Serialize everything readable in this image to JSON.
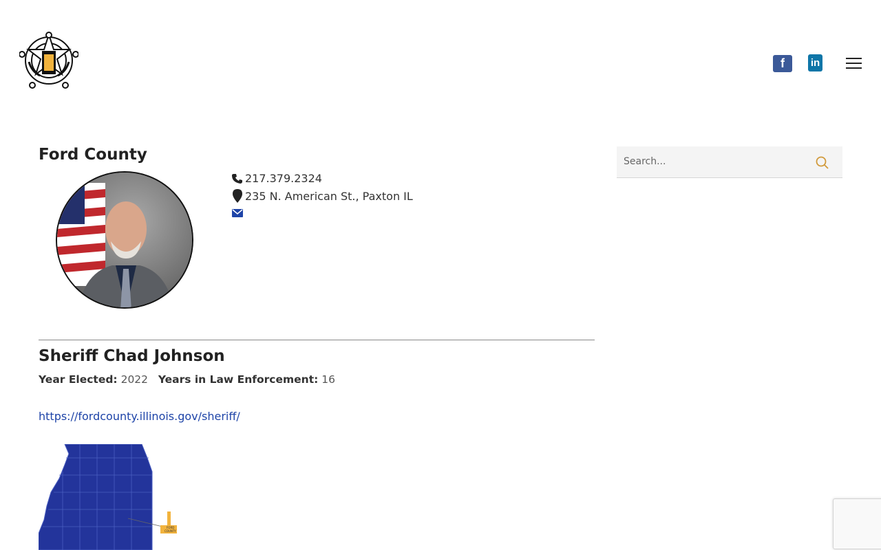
{
  "header": {
    "logo_name": "Illinois Sheriffs' Association seal",
    "facebook_label": "f",
    "linkedin_label": "in"
  },
  "profile": {
    "county": "Ford County",
    "phone": "217.379.2324",
    "address": "235 N. American St., Paxton IL",
    "sheriff_name": "Sheriff Chad Johnson",
    "year_elected_label": "Year Elected:",
    "year_elected": "2022",
    "years_enforcement_label": "Years in Law Enforcement:",
    "years_enforcement": "16",
    "website": "https://fordcounty.illinois.gov/sheriff/"
  },
  "map": {
    "county_label_line1": "FORD",
    "county_label_line2": "COUNTY",
    "state_color": "#23349b",
    "highlight_color": "#f2b33d"
  },
  "sidebar": {
    "search_placeholder": "Search..."
  },
  "colors": {
    "link": "#1e44a8",
    "search_icon": "#d19a3b",
    "facebook": "#3b5998",
    "linkedin": "#0e76a8"
  }
}
